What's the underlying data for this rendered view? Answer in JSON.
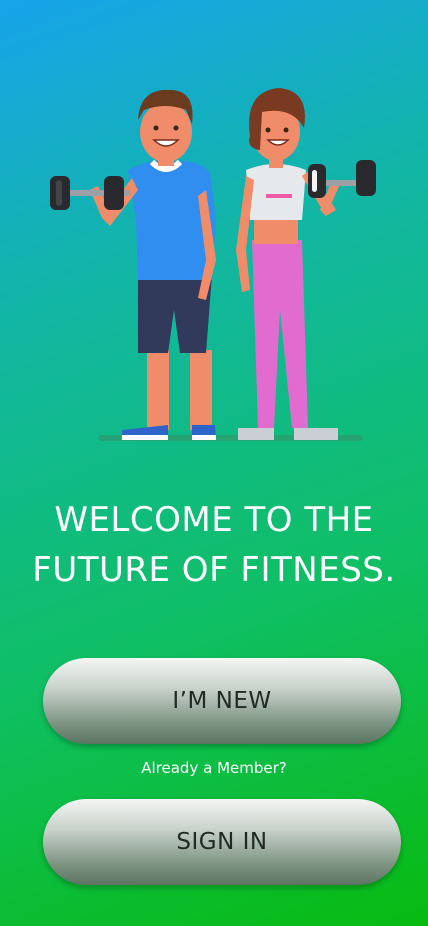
{
  "welcome": {
    "line1": "WELCOME TO THE",
    "line2": "FUTURE OF FITNESS."
  },
  "buttons": {
    "new_label": "I’M NEW",
    "signin_label": "SIGN IN"
  },
  "member_prompt": "Already a Member?",
  "illustration": {
    "icon": "fitness-couple-illustration"
  },
  "colors": {
    "gradient_top": "#17a3ea",
    "gradient_bottom": "#08bb10",
    "button_light": "#f4f6f4",
    "button_dark": "#5d7463"
  }
}
